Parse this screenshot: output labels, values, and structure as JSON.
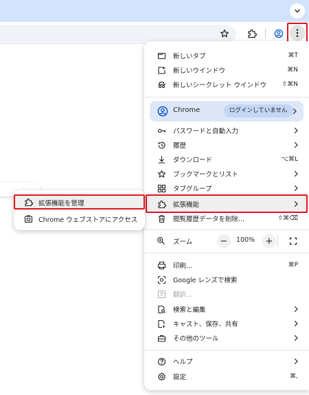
{
  "menu": {
    "new_tab": {
      "label": "新しいタブ",
      "shortcut": "⌘T"
    },
    "new_window": {
      "label": "新しいウインドウ",
      "shortcut": "⌘N"
    },
    "new_incognito": {
      "label": "新しいシークレット ウインドウ",
      "shortcut": "⇧⌘N"
    },
    "profile": {
      "label": "Chrome",
      "badge": "ログインしていません"
    },
    "passwords": {
      "label": "パスワードと自動入力"
    },
    "history": {
      "label": "履歴"
    },
    "downloads": {
      "label": "ダウンロード",
      "shortcut": "⌥⌘L"
    },
    "bookmarks": {
      "label": "ブックマークとリスト"
    },
    "tab_groups": {
      "label": "タブグループ"
    },
    "extensions": {
      "label": "拡張機能"
    },
    "clear_data": {
      "label": "閲覧履歴データを削除...",
      "shortcut": "⇧⌘⌫"
    },
    "zoom": {
      "label": "ズーム",
      "minus": "−",
      "value": "100%",
      "plus": "+"
    },
    "print": {
      "label": "印刷...",
      "shortcut": "⌘P"
    },
    "google_lens": {
      "label": "Google レンズで検索"
    },
    "translate": {
      "label": "翻訳..."
    },
    "find_edit": {
      "label": "検索と編集"
    },
    "cast_save_share": {
      "label": "キャスト、保存、共有"
    },
    "more_tools": {
      "label": "その他のツール"
    },
    "help": {
      "label": "ヘルプ"
    },
    "settings": {
      "label": "設定",
      "shortcut": "⌘,"
    }
  },
  "submenu": {
    "manage_extensions": {
      "label": "拡張機能を管理"
    },
    "web_store": {
      "label": "Chrome ウェブストアにアクセス"
    }
  },
  "colors": {
    "highlight_border": "#e0141e",
    "tabstrip": "#d3e3fd",
    "profile_bg": "#dde7f8",
    "profile_badge": "#c3d6f5",
    "profile_icon": "#0b57d0"
  }
}
